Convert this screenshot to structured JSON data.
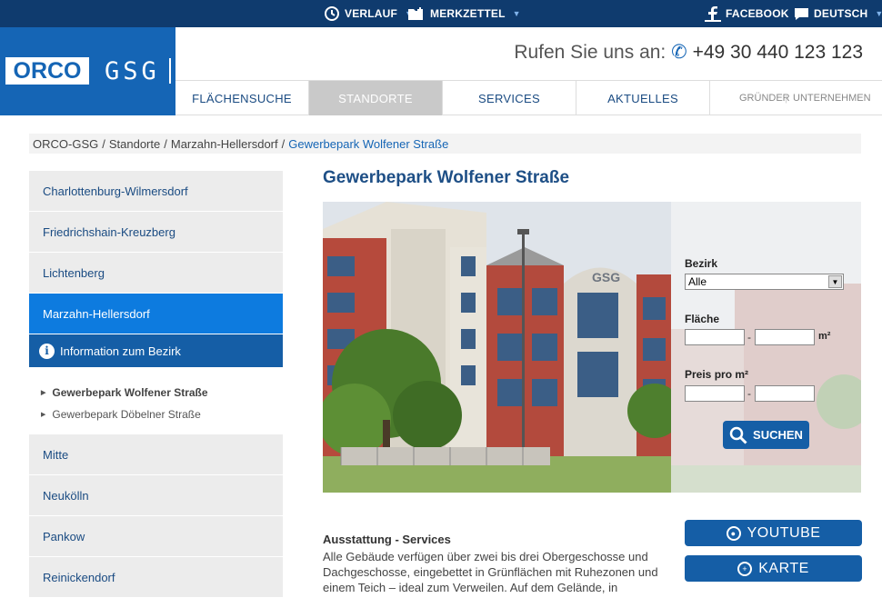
{
  "topbar": {
    "verlauf": "VERLAUF",
    "merkzettel": "MERKZETTEL",
    "facebook": "FACEBOOK",
    "language": "DEUTSCH"
  },
  "logo": {
    "orco": "ORCO",
    "gsg": "GSG"
  },
  "header": {
    "phone_label": "Rufen Sie uns an:",
    "phone_number": "+49 30 440 123 123"
  },
  "nav": {
    "items": [
      "FLÄCHENSUCHE",
      "STANDORTE",
      "SERVICES",
      "AKTUELLES"
    ],
    "active": "STANDORTE",
    "sub": [
      "GRÜNDER",
      "UNTERNEHMEN"
    ]
  },
  "breadcrumb": {
    "items": [
      "ORCO-GSG",
      "Standorte",
      "Marzahn-Hellersdorf"
    ],
    "separator": "/",
    "current": "Gewerbepark Wolfener Straße"
  },
  "sidebar": {
    "items_top": [
      "Charlottenburg-Wilmersdorf",
      "Friedrichshain-Kreuzberg",
      "Lichtenberg",
      "Marzahn-Hellersdorf"
    ],
    "info": "Information zum Bezirk",
    "sub_items": [
      "Gewerbepark Wolfener Straße",
      "Gewerbepark Döbelner Straße"
    ],
    "items_bottom": [
      "Mitte",
      "Neukölln",
      "Pankow",
      "Reinickendorf"
    ]
  },
  "main": {
    "title": "Gewerbepark Wolfener Straße",
    "desc_heading": "Ausstattung - Services",
    "desc_text": "Alle Gebäude verfügen über zwei bis drei Obergeschosse und Dachgeschosse, eingebettet in Grünflächen mit Ruhezonen und einem Teich – ideal zum Verweilen. Auf dem Gelände, in"
  },
  "search": {
    "bezirk_label": "Bezirk",
    "bezirk_value": "Alle",
    "flaeche_label": "Fläche",
    "flaeche_unit": "m²",
    "preis_label": "Preis pro m²",
    "dash": "-",
    "button": "SUCHEN"
  },
  "media": {
    "youtube": "YOUTUBE",
    "karte": "KARTE"
  },
  "colors": {
    "navy": "#0f3b6e",
    "brand_blue": "#1565b5",
    "active_blue": "#0d7bdf",
    "button_blue": "#155ea6"
  }
}
